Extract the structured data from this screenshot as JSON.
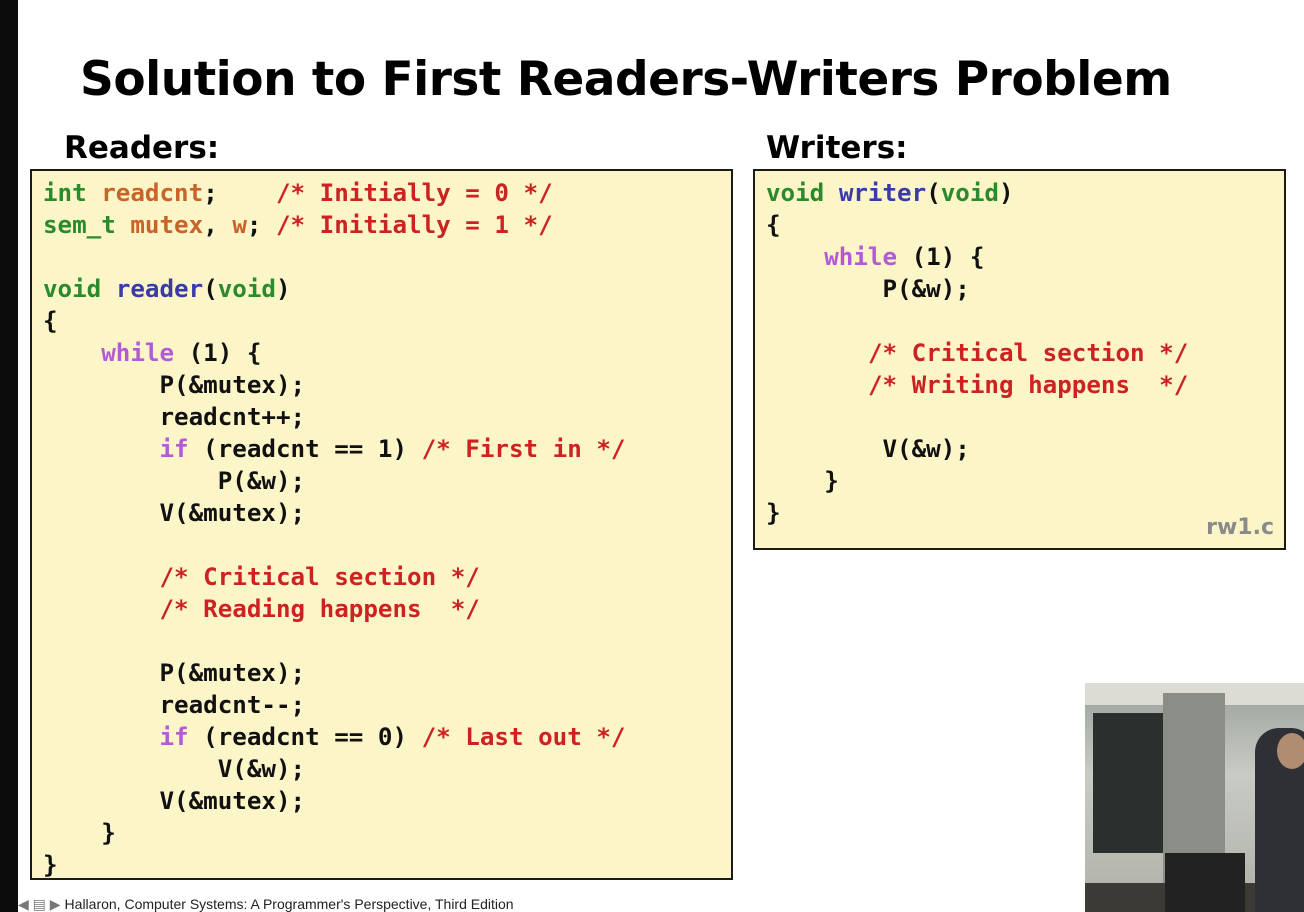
{
  "slide": {
    "title": "Solution to First Readers-Writers Problem",
    "readers_label": "Readers:",
    "writers_label": "Writers:",
    "filename": "rw1.c",
    "footer": "Hallaron, Computer Systems: A Programmer's Perspective, Third Edition"
  },
  "readers_code": [
    [
      {
        "t": "int",
        "c": "kw-green"
      },
      {
        "t": " "
      },
      {
        "t": "readcnt",
        "c": "var-orange"
      },
      {
        "t": ";    "
      },
      {
        "t": "/* Initially = 0 */",
        "c": "comment"
      }
    ],
    [
      {
        "t": "sem_t",
        "c": "kw-green"
      },
      {
        "t": " "
      },
      {
        "t": "mutex",
        "c": "var-orange"
      },
      {
        "t": ", "
      },
      {
        "t": "w",
        "c": "var-orange"
      },
      {
        "t": "; "
      },
      {
        "t": "/* Initially = 1 */",
        "c": "comment"
      }
    ],
    [
      {
        "t": ""
      }
    ],
    [
      {
        "t": "void",
        "c": "kw-green"
      },
      {
        "t": " "
      },
      {
        "t": "reader",
        "c": "fn-blue"
      },
      {
        "t": "("
      },
      {
        "t": "void",
        "c": "kw-green"
      },
      {
        "t": ")"
      }
    ],
    [
      {
        "t": "{"
      }
    ],
    [
      {
        "t": "    "
      },
      {
        "t": "while",
        "c": "kw-purple"
      },
      {
        "t": " (1) {"
      }
    ],
    [
      {
        "t": "        P(&mutex);"
      }
    ],
    [
      {
        "t": "        readcnt++;"
      }
    ],
    [
      {
        "t": "        "
      },
      {
        "t": "if",
        "c": "kw-purple"
      },
      {
        "t": " (readcnt == 1) "
      },
      {
        "t": "/* First in */",
        "c": "comment"
      }
    ],
    [
      {
        "t": "            P(&w);"
      }
    ],
    [
      {
        "t": "        V(&mutex);"
      }
    ],
    [
      {
        "t": ""
      }
    ],
    [
      {
        "t": "        "
      },
      {
        "t": "/* Critical section */",
        "c": "comment"
      }
    ],
    [
      {
        "t": "        "
      },
      {
        "t": "/* Reading happens  */",
        "c": "comment"
      }
    ],
    [
      {
        "t": ""
      }
    ],
    [
      {
        "t": "        P(&mutex);"
      }
    ],
    [
      {
        "t": "        readcnt--;"
      }
    ],
    [
      {
        "t": "        "
      },
      {
        "t": "if",
        "c": "kw-purple"
      },
      {
        "t": " (readcnt == 0) "
      },
      {
        "t": "/* Last out */",
        "c": "comment"
      }
    ],
    [
      {
        "t": "            V(&w);"
      }
    ],
    [
      {
        "t": "        V(&mutex);"
      }
    ],
    [
      {
        "t": "    }"
      }
    ],
    [
      {
        "t": "}"
      }
    ]
  ],
  "writers_code": [
    [
      {
        "t": "void",
        "c": "kw-green"
      },
      {
        "t": " "
      },
      {
        "t": "writer",
        "c": "fn-blue"
      },
      {
        "t": "("
      },
      {
        "t": "void",
        "c": "kw-green"
      },
      {
        "t": ")"
      }
    ],
    [
      {
        "t": "{"
      }
    ],
    [
      {
        "t": "    "
      },
      {
        "t": "while",
        "c": "kw-purple"
      },
      {
        "t": " (1) {"
      }
    ],
    [
      {
        "t": "        P(&w);"
      }
    ],
    [
      {
        "t": ""
      }
    ],
    [
      {
        "t": "       "
      },
      {
        "t": "/* Critical section */",
        "c": "comment"
      }
    ],
    [
      {
        "t": "       "
      },
      {
        "t": "/* Writing happens  */",
        "c": "comment"
      }
    ],
    [
      {
        "t": ""
      }
    ],
    [
      {
        "t": "        V(&w);"
      }
    ],
    [
      {
        "t": "    }"
      }
    ],
    [
      {
        "t": "}"
      }
    ]
  ]
}
